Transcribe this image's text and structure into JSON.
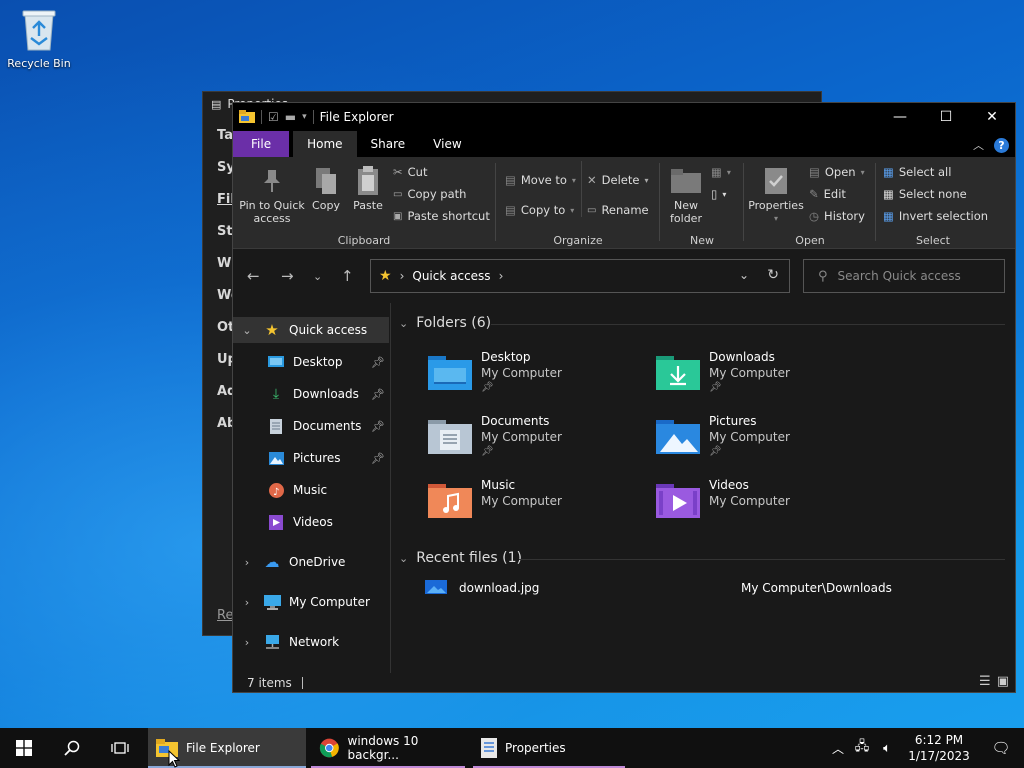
{
  "desktop": {
    "recycle_bin_label": "Recycle Bin"
  },
  "background_window": {
    "title": "Properties",
    "items": [
      "Ta",
      "Sy",
      "Fil",
      "Sta",
      "Wi",
      "Wo",
      "Ot",
      "Up",
      "Ad",
      "Ab",
      "Re"
    ]
  },
  "explorer": {
    "title": "File Explorer",
    "tabs": {
      "file": "File",
      "home": "Home",
      "share": "Share",
      "view": "View"
    },
    "ribbon": {
      "clipboard": {
        "label": "Clipboard",
        "pin": "Pin to Quick access",
        "copy": "Copy",
        "paste": "Paste",
        "cut": "Cut",
        "copy_path": "Copy path",
        "paste_shortcut": "Paste shortcut"
      },
      "organize": {
        "label": "Organize",
        "move_to": "Move to",
        "copy_to": "Copy to",
        "delete": "Delete",
        "rename": "Rename"
      },
      "new": {
        "label": "New",
        "new_folder": "New folder"
      },
      "open": {
        "label": "Open",
        "properties": "Properties",
        "open": "Open",
        "edit": "Edit",
        "history": "History"
      },
      "select": {
        "label": "Select",
        "select_all": "Select all",
        "select_none": "Select none",
        "invert": "Invert selection"
      }
    },
    "address": {
      "path": "Quick access"
    },
    "search": {
      "placeholder": "Search Quick access"
    },
    "nav": {
      "quick_access": "Quick access",
      "items": [
        "Desktop",
        "Downloads",
        "Documents",
        "Pictures",
        "Music",
        "Videos"
      ],
      "onedrive": "OneDrive",
      "my_computer": "My Computer",
      "network": "Network"
    },
    "folders_header": "Folders (6)",
    "folders": [
      {
        "name": "Desktop",
        "location": "My Computer"
      },
      {
        "name": "Downloads",
        "location": "My Computer"
      },
      {
        "name": "Documents",
        "location": "My Computer"
      },
      {
        "name": "Pictures",
        "location": "My Computer"
      },
      {
        "name": "Music",
        "location": "My Computer"
      },
      {
        "name": "Videos",
        "location": "My Computer"
      }
    ],
    "recent_header": "Recent files (1)",
    "recent_files": [
      {
        "name": "download.jpg",
        "path": "My Computer\\Downloads"
      }
    ],
    "status": {
      "items": "7 items"
    }
  },
  "taskbar": {
    "apps": [
      {
        "label": "File Explorer"
      },
      {
        "label": "windows 10 backgr..."
      },
      {
        "label": "Properties"
      }
    ],
    "time": "6:12 PM",
    "date": "1/17/2023"
  }
}
